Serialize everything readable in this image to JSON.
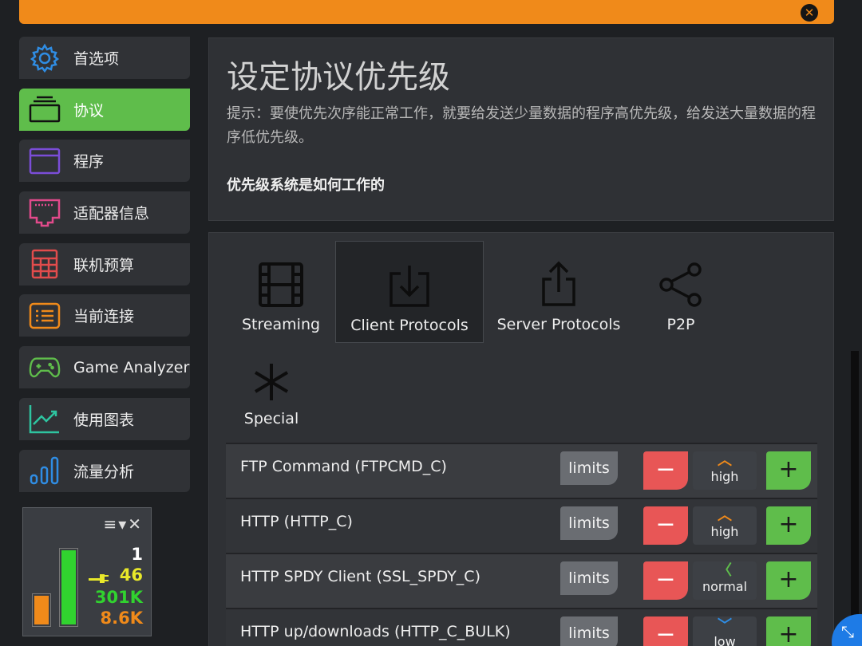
{
  "sidebar": {
    "items": [
      {
        "label": "首选项",
        "icon": "gear-icon",
        "color": "#2f8de4"
      },
      {
        "label": "协议",
        "icon": "layers-icon",
        "color": "#111111"
      },
      {
        "label": "程序",
        "icon": "window-icon",
        "color": "#7b4dd8"
      },
      {
        "label": "适配器信息",
        "icon": "ethernet-port-icon",
        "color": "#e24a8b"
      },
      {
        "label": "联机预算",
        "icon": "calculator-icon",
        "color": "#e24c4c"
      },
      {
        "label": "当前连接",
        "icon": "list-icon",
        "color": "#f08a1a"
      },
      {
        "label": "Game Analyzer",
        "icon": "gamepad-icon",
        "color": "#5fbd4b"
      },
      {
        "label": "使用图表",
        "icon": "line-chart-icon",
        "color": "#2ec4a0"
      },
      {
        "label": "流量分析",
        "icon": "bar-chart-icon",
        "color": "#2f8de4"
      }
    ],
    "active_index": 1
  },
  "meter": {
    "controls": "≡▾✕",
    "value1": "1",
    "value2": "46",
    "value3": "301K",
    "value4": "8.6K",
    "bar_orange_level": 0.36,
    "bar_green_level": 0.88,
    "colors": {
      "white": "#ffffff",
      "yellow": "#e8e82a",
      "green": "#31d32f",
      "orange": "#f08a1a"
    }
  },
  "header": {
    "title": "设定协议优先级",
    "hint": "提示：要使优先次序能正常工作，就要给发送少量数据的程序高优先级，给发送大量数据的程序低优先级。",
    "how_link": "优先级系统是如何工作的"
  },
  "tabs": [
    {
      "label": "Streaming",
      "icon": "film-icon"
    },
    {
      "label": "Client Protocols",
      "icon": "download-icon"
    },
    {
      "label": "Server Protocols",
      "icon": "share-upload-icon"
    },
    {
      "label": "P2P",
      "icon": "share-nodes-icon"
    },
    {
      "label": "Special",
      "icon": "asterisk-icon"
    }
  ],
  "active_tab": 1,
  "protocols": [
    {
      "name": "FTP Command (FTPCMD_C)",
      "priority": "high",
      "arrow": "^",
      "arrow_color": "#f08a1a"
    },
    {
      "name": "HTTP (HTTP_C)",
      "priority": "high",
      "arrow": "^",
      "arrow_color": "#f08a1a"
    },
    {
      "name": "HTTP SPDY Client (SSL_SPDY_C)",
      "priority": "normal",
      "arrow": "<",
      "arrow_color": "#5fbd4b"
    },
    {
      "name": "HTTP up/downloads (HTTP_C_BULK)",
      "priority": "low",
      "arrow": "v",
      "arrow_color": "#2f8de4"
    }
  ],
  "buttons": {
    "limits": "limits",
    "minus": "−",
    "plus": "+"
  }
}
